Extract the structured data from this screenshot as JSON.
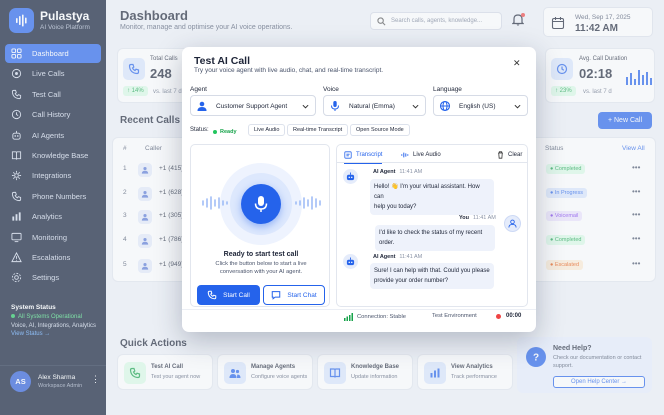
{
  "brand": {
    "name": "Pulastya",
    "subtitle": "AI Voice Platform"
  },
  "sidebar": {
    "items": [
      {
        "label": "Dashboard",
        "icon": "dashboard-icon",
        "active": true
      },
      {
        "label": "Live Calls",
        "icon": "live-calls-icon"
      },
      {
        "label": "Test Call",
        "icon": "phone-icon"
      },
      {
        "label": "Call History",
        "icon": "history-icon"
      },
      {
        "label": "AI Agents",
        "icon": "agents-icon"
      },
      {
        "label": "Knowledge Base",
        "icon": "book-icon"
      },
      {
        "label": "Integrations",
        "icon": "integrations-icon"
      },
      {
        "label": "Phone Numbers",
        "icon": "phone-numbers-icon"
      },
      {
        "label": "Analytics",
        "icon": "analytics-icon"
      },
      {
        "label": "Monitoring",
        "icon": "monitoring-icon"
      },
      {
        "label": "Escalations",
        "icon": "escalation-icon"
      },
      {
        "label": "Settings",
        "icon": "gear-icon"
      }
    ],
    "system_status": {
      "title": "System Status",
      "state": "All Systems Operational",
      "detail": "Voice, AI, Integrations, Analytics",
      "link": "View Status"
    },
    "user": {
      "initials": "AS",
      "name": "Alex Sharma",
      "role": "Workspace Admin",
      "menu": "⋮"
    }
  },
  "header": {
    "title": "Dashboard",
    "subtitle": "Monitor, manage and optimise your AI voice operations.",
    "search_placeholder": "Search calls, agents, knowledge...",
    "date": "Wed, Sep 17, 2025",
    "time": "11:42 AM"
  },
  "stats": {
    "total_calls": {
      "label": "Total Calls",
      "value": "248",
      "change": "14%",
      "vs": "vs. last 7 d"
    },
    "avg_duration": {
      "label": "Avg. Call Duration",
      "value": "02:18",
      "change": "23%",
      "vs": "vs. last 7 d"
    }
  },
  "recent_calls": {
    "title": "Recent Calls",
    "new_call": "+ New Call",
    "view_all": "View All",
    "columns": {
      "num": "#",
      "caller": "Caller",
      "status": "Status"
    },
    "rows": [
      {
        "num": "1",
        "phone": "+1 (415)",
        "status": "Completed",
        "color": "#16a34a",
        "bg": "#dcfce7"
      },
      {
        "num": "2",
        "phone": "+1 (628)",
        "status": "In Progress",
        "color": "#2563eb",
        "bg": "#dbe7fd"
      },
      {
        "num": "3",
        "phone": "+1 (305)",
        "status": "Voicemail",
        "color": "#7c3aed",
        "bg": "#ede4fe"
      },
      {
        "num": "4",
        "phone": "+1 (786)",
        "status": "Completed",
        "color": "#16a34a",
        "bg": "#dcfce7"
      },
      {
        "num": "5",
        "phone": "+1 (949)",
        "status": "Escalated",
        "color": "#ea580c",
        "bg": "#ffedd5"
      }
    ],
    "row_menu": "•••"
  },
  "quick_actions": {
    "title": "Quick Actions",
    "items": [
      {
        "title": "Test AI Call",
        "sub": "Test your agent now"
      },
      {
        "title": "Manage Agents",
        "sub": "Configure voice agents"
      },
      {
        "title": "Knowledge Base",
        "sub": "Update information"
      },
      {
        "title": "View Analytics",
        "sub": "Track performance"
      }
    ]
  },
  "help": {
    "title": "Need Help?",
    "text": "Check our documentation or contact support.",
    "button": "Open Help Center →"
  },
  "modal": {
    "title": "Test AI Call",
    "subtitle": "Try your voice agent with live audio, chat, and real-time transcript.",
    "close": "✕",
    "agent": {
      "label": "Agent",
      "value": "Customer Support Agent"
    },
    "voice": {
      "label": "Voice",
      "value": "Natural (Emma)"
    },
    "language": {
      "label": "Language",
      "value": "English (US)"
    },
    "status_label": "Status:",
    "chips": [
      "Ready",
      "Live Audio",
      "Real-time Transcript",
      "Open Source Mode"
    ],
    "ready_title": "Ready to start test call",
    "ready_text": "Click the button below to start a live conversation with your AI agent.",
    "start_call": "Start Call",
    "start_chat": "Start Chat",
    "tabs": {
      "transcript": "Transcript",
      "live_audio": "Live Audio",
      "clear": "Clear"
    },
    "messages": [
      {
        "who": "AI Agent",
        "time": "11:41 AM",
        "text_1": "Hello! 👋 I'm your virtual assistant. How can",
        "text_2": "help you today?"
      },
      {
        "who": "You",
        "time": "11:41 AM",
        "text_1": "I'd like to check the status of my recent order."
      },
      {
        "who": "AI Agent",
        "time": "11:41 AM",
        "text_1": "Sure! I can help with that. Could you please",
        "text_2": "provide your order number?"
      }
    ],
    "connection": "Connection: Stable",
    "environment": "Test Environment",
    "timer": "00:00"
  }
}
